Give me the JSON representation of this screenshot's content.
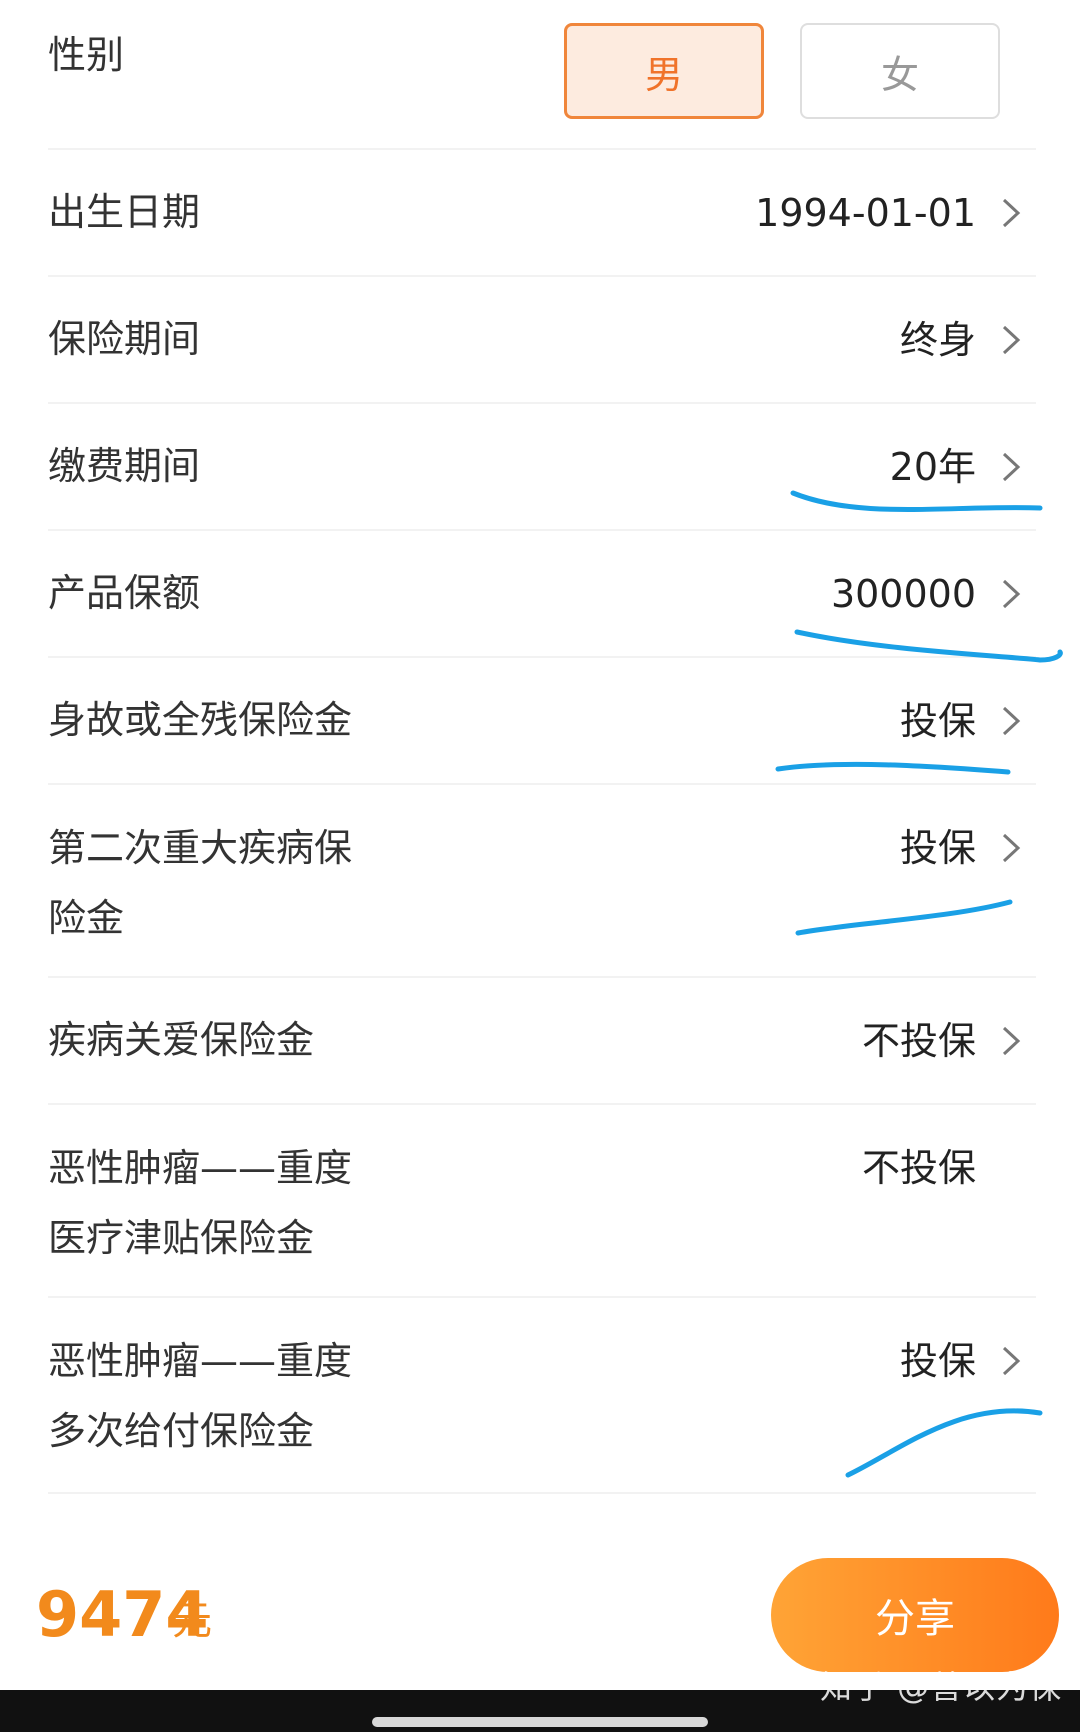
{
  "form": {
    "gender": {
      "label": "性别",
      "male": "男",
      "female": "女",
      "selected": "男"
    },
    "rows": [
      {
        "label": "出生日期",
        "value": "1994-01-01"
      },
      {
        "label": "保险期间",
        "value": "终身"
      },
      {
        "label": "缴费期间",
        "value": "20年"
      },
      {
        "label": "产品保额",
        "value": "300000"
      },
      {
        "label": "身故或全残保险金",
        "value": "投保"
      },
      {
        "label": "第二次重大疾病保\n险金",
        "value": "投保"
      },
      {
        "label": "疾病关爱保险金",
        "value": "不投保"
      },
      {
        "label": "恶性肿瘤——重度\n医疗津贴保险金",
        "value": "不投保"
      },
      {
        "label": "恶性肿瘤——重度\n多次给付保险金",
        "value": "投保"
      }
    ]
  },
  "footer": {
    "price": "9474",
    "unit": "元",
    "share_label": "分享",
    "watermark": "知乎 @善以为保"
  },
  "colors": {
    "accent": "#f28a1c",
    "annotation_ink": "#1aa0e6"
  },
  "icons": {
    "chevron": "chevron-right-icon"
  }
}
